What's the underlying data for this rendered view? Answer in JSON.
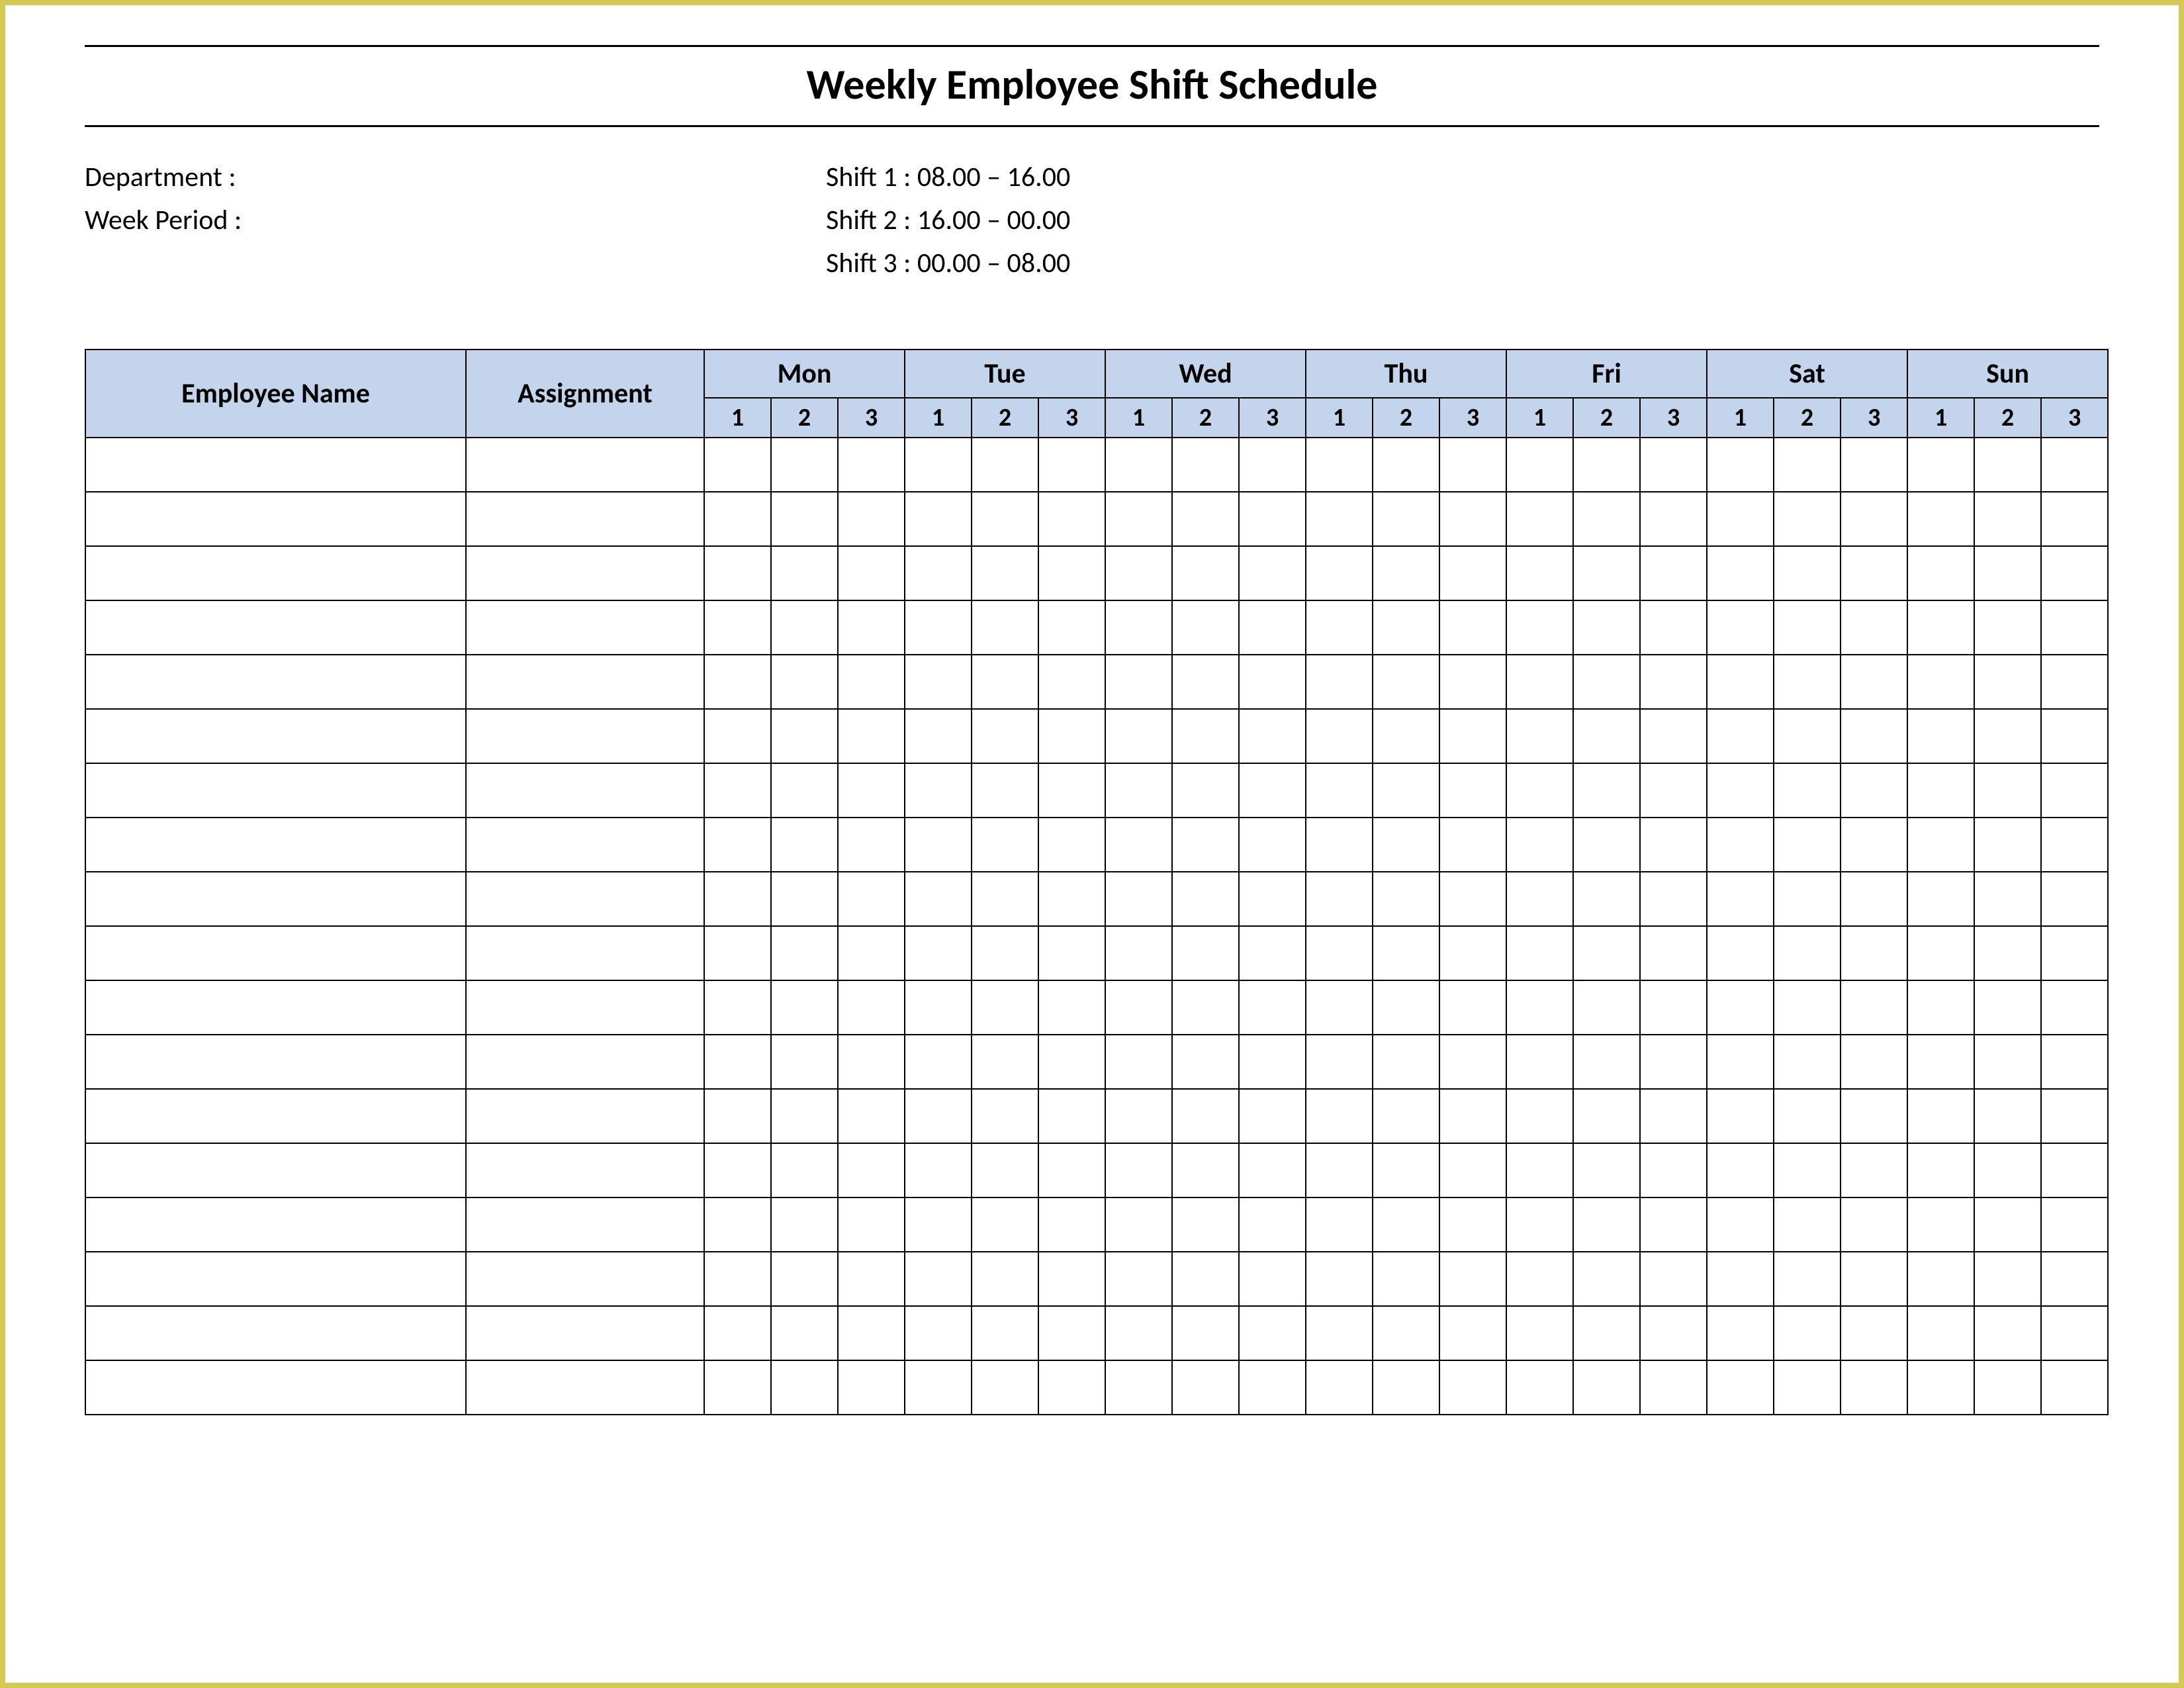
{
  "title": "Weekly Employee Shift Schedule",
  "meta": {
    "department_label": "Department    :",
    "week_period_label": "Week  Period :",
    "shift1": "Shift 1  : 08.00  – 16.00",
    "shift2": "Shift 2  : 16.00  – 00.00",
    "shift3": "Shift 3  : 00.00  – 08.00"
  },
  "header": {
    "employee": "Employee Name",
    "assignment": "Assignment",
    "days": [
      "Mon",
      "Tue",
      "Wed",
      "Thu",
      "Fri",
      "Sat",
      "Sun"
    ],
    "subs": [
      "1",
      "2",
      "3"
    ]
  },
  "row_count": 18
}
